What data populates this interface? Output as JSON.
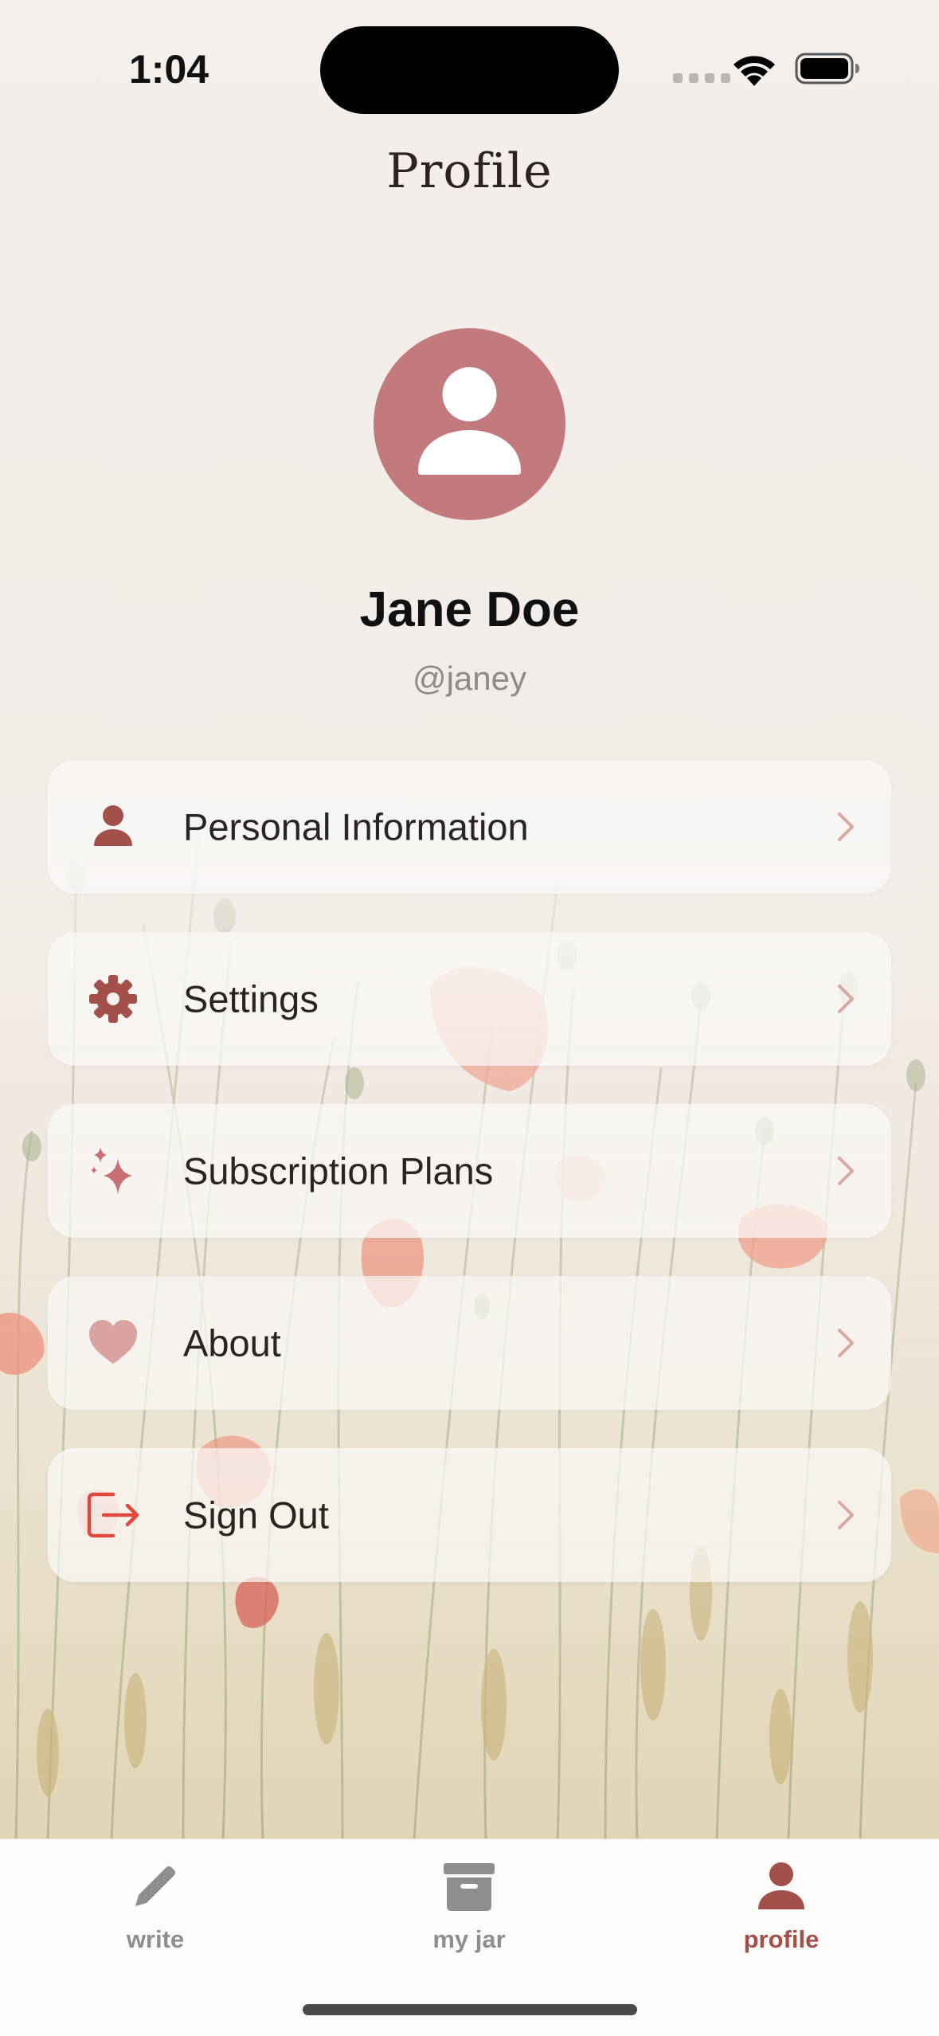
{
  "status_bar": {
    "time": "1:04"
  },
  "header": {
    "title": "Profile"
  },
  "profile": {
    "name": "Jane Doe",
    "handle": "@janey"
  },
  "menu": {
    "items": [
      {
        "label": "Personal Information",
        "icon": "person-icon"
      },
      {
        "label": "Settings",
        "icon": "gear-icon"
      },
      {
        "label": "Subscription Plans",
        "icon": "sparkles-icon"
      },
      {
        "label": "About",
        "icon": "heart-icon"
      },
      {
        "label": "Sign Out",
        "icon": "sign-out-icon"
      }
    ]
  },
  "tab_bar": {
    "tabs": [
      {
        "label": "write",
        "icon": "pencil-icon",
        "active": false
      },
      {
        "label": "my jar",
        "icon": "archive-box-icon",
        "active": false
      },
      {
        "label": "profile",
        "icon": "person-icon",
        "active": true
      }
    ]
  },
  "colors": {
    "accent": "#a4504a",
    "avatar": "#c37a7d",
    "sign_out": "#e0483d",
    "inactive_tab": "#8e8e8e"
  }
}
